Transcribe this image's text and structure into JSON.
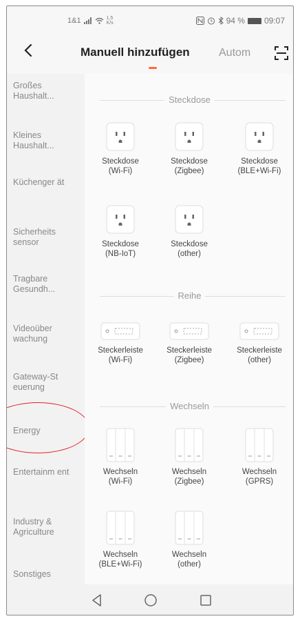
{
  "status_bar": {
    "left_text": "1&1",
    "speed_value": "1,5",
    "speed_unit": "K/s",
    "battery": "94 %",
    "time": "09:07"
  },
  "header": {
    "title": "Manuell hinzufügen",
    "tab_auto": "Autom",
    "accent_color": "#ff6b35"
  },
  "sidebar": {
    "items": [
      {
        "label": "Großes Haushalt..."
      },
      {
        "label": "Kleines Haushalt..."
      },
      {
        "label": "Küchenger ät"
      },
      {
        "label": "Sicherheits sensor"
      },
      {
        "label": "Tragbare Gesundh..."
      },
      {
        "label": "Videoüber wachung"
      },
      {
        "label": "Gateway-St euerung"
      },
      {
        "label": "Energy"
      },
      {
        "label": "Entertainm ent"
      },
      {
        "label": "Industry & Agriculture"
      },
      {
        "label": "Sonstiges"
      }
    ],
    "highlight_color": "#e0202a"
  },
  "sections": [
    {
      "title": "Steckdose",
      "devices": [
        {
          "line1": "Steckdose",
          "line2": "(Wi-Fi)",
          "icon": "socket-icon"
        },
        {
          "line1": "Steckdose",
          "line2": "(Zigbee)",
          "icon": "socket-icon"
        },
        {
          "line1": "Steckdose",
          "line2": "(BLE+Wi-Fi)",
          "icon": "socket-icon"
        },
        {
          "line1": "Steckdose",
          "line2": "(NB-IoT)",
          "icon": "socket-icon"
        },
        {
          "line1": "Steckdose",
          "line2": "(other)",
          "icon": "socket-icon"
        }
      ]
    },
    {
      "title": "Reihe",
      "devices": [
        {
          "line1": "Steckerleiste",
          "line2": "(Wi-Fi)",
          "icon": "power-strip-icon"
        },
        {
          "line1": "Steckerleiste",
          "line2": "(Zigbee)",
          "icon": "power-strip-icon"
        },
        {
          "line1": "Steckerleiste",
          "line2": "(other)",
          "icon": "power-strip-icon"
        }
      ]
    },
    {
      "title": "Wechseln",
      "devices": [
        {
          "line1": "Wechseln",
          "line2": "(Wi-Fi)",
          "icon": "wall-switch-icon"
        },
        {
          "line1": "Wechseln",
          "line2": "(Zigbee)",
          "icon": "wall-switch-icon"
        },
        {
          "line1": "Wechseln",
          "line2": "(GPRS)",
          "icon": "wall-switch-icon"
        },
        {
          "line1": "Wechseln",
          "line2": "(BLE+Wi-Fi)",
          "icon": "wall-switch-icon"
        },
        {
          "line1": "Wechseln",
          "line2": "(other)",
          "icon": "wall-switch-icon"
        }
      ]
    }
  ]
}
